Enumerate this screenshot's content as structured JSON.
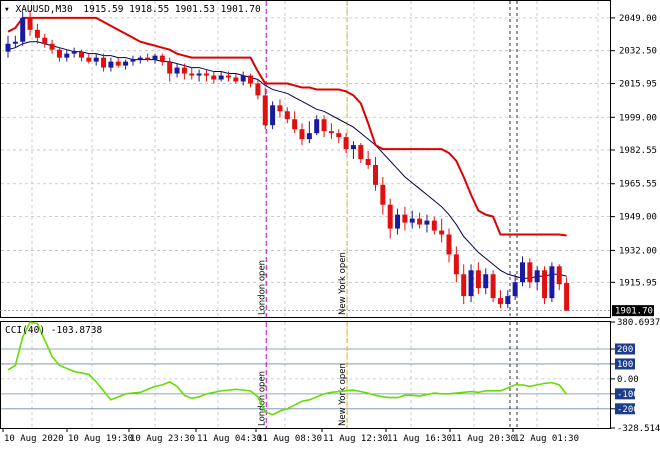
{
  "window": {
    "symbol_line": "XAUUSD,M30",
    "ohlc": "1915.59 1918.55 1901.53 1901.70",
    "cci_label": "CCI(40) -103.8738"
  },
  "price_axis": {
    "ticks": [
      "2049.00",
      "2032.50",
      "2015.95",
      "1999.00",
      "1982.55",
      "1965.55",
      "1949.00",
      "1932.00",
      "1915.95"
    ],
    "tick_values": [
      2049.0,
      2032.5,
      2015.95,
      1999.0,
      1982.55,
      1965.55,
      1949.0,
      1932.0,
      1915.95
    ],
    "current_price": "1901.70",
    "range": [
      1898.5,
      2057.5
    ]
  },
  "cci_axis": {
    "ticks": [
      "380.6937",
      "200",
      "100",
      "0.00",
      "-100",
      "-200",
      "-328.514"
    ],
    "tick_values": [
      380.69,
      200,
      100,
      0,
      -100,
      -200,
      -328.51
    ],
    "badge_ticks": [
      "200",
      "100",
      "-100",
      "-200"
    ],
    "range": [
      -328.514,
      380.6937
    ]
  },
  "time_axis": {
    "labels": [
      "10 Aug 2020",
      "10 Aug 19:30",
      "10 Aug 23:30",
      "11 Aug 04:30",
      "11 Aug 08:30",
      "11 Aug 12:30",
      "11 Aug 16:30",
      "11 Aug 20:30",
      "12 Aug 01:30"
    ]
  },
  "session_lines": [
    {
      "label": "London open",
      "color": "#c000c0",
      "bar": 35
    },
    {
      "label": "New York open",
      "color": "#e8b000",
      "bar": 46
    }
  ],
  "colors": {
    "bull": "#1a1aa0",
    "bear": "#e01010",
    "ma": "#000050",
    "stop_line": "#dd0000",
    "cci_line": "#66dd00",
    "grid": "#b8c0c8",
    "badge": "#1c3c8c",
    "price_badge": "#000000"
  },
  "chart_data": [
    {
      "type": "candlestick",
      "title": "XAUUSD,M30",
      "candles": [
        {
          "o": 2032,
          "h": 2040,
          "l": 2029,
          "c": 2036
        },
        {
          "o": 2036,
          "h": 2040,
          "l": 2034,
          "c": 2037
        },
        {
          "o": 2037,
          "h": 2052,
          "l": 2035,
          "c": 2049
        },
        {
          "o": 2049,
          "h": 2053,
          "l": 2040,
          "c": 2043
        },
        {
          "o": 2043,
          "h": 2046,
          "l": 2036,
          "c": 2039
        },
        {
          "o": 2039,
          "h": 2041,
          "l": 2034,
          "c": 2036
        },
        {
          "o": 2036,
          "h": 2038,
          "l": 2031,
          "c": 2033
        },
        {
          "o": 2033,
          "h": 2034,
          "l": 2027,
          "c": 2029
        },
        {
          "o": 2029,
          "h": 2033,
          "l": 2027,
          "c": 2031
        },
        {
          "o": 2031,
          "h": 2034,
          "l": 2029,
          "c": 2032
        },
        {
          "o": 2032,
          "h": 2033,
          "l": 2027,
          "c": 2029
        },
        {
          "o": 2029,
          "h": 2031,
          "l": 2026,
          "c": 2027
        },
        {
          "o": 2027,
          "h": 2031,
          "l": 2025,
          "c": 2029
        },
        {
          "o": 2029,
          "h": 2031,
          "l": 2022,
          "c": 2024
        },
        {
          "o": 2024,
          "h": 2029,
          "l": 2022,
          "c": 2027
        },
        {
          "o": 2027,
          "h": 2029,
          "l": 2024,
          "c": 2025
        },
        {
          "o": 2025,
          "h": 2028,
          "l": 2023,
          "c": 2027
        },
        {
          "o": 2027,
          "h": 2030,
          "l": 2025,
          "c": 2028
        },
        {
          "o": 2028,
          "h": 2030,
          "l": 2026,
          "c": 2029
        },
        {
          "o": 2029,
          "h": 2031,
          "l": 2027,
          "c": 2028
        },
        {
          "o": 2028,
          "h": 2031,
          "l": 2026,
          "c": 2030
        },
        {
          "o": 2030,
          "h": 2031,
          "l": 2025,
          "c": 2027
        },
        {
          "o": 2027,
          "h": 2029,
          "l": 2017,
          "c": 2021
        },
        {
          "o": 2021,
          "h": 2026,
          "l": 2019,
          "c": 2024
        },
        {
          "o": 2024,
          "h": 2026,
          "l": 2018,
          "c": 2021
        },
        {
          "o": 2021,
          "h": 2024,
          "l": 2018,
          "c": 2020
        },
        {
          "o": 2020,
          "h": 2023,
          "l": 2017,
          "c": 2021
        },
        {
          "o": 2021,
          "h": 2023,
          "l": 2017,
          "c": 2020
        },
        {
          "o": 2020,
          "h": 2022,
          "l": 2016,
          "c": 2018
        },
        {
          "o": 2018,
          "h": 2022,
          "l": 2017,
          "c": 2020
        },
        {
          "o": 2020,
          "h": 2022,
          "l": 2017,
          "c": 2019
        },
        {
          "o": 2019,
          "h": 2021,
          "l": 2016,
          "c": 2017
        },
        {
          "o": 2017,
          "h": 2022,
          "l": 2015,
          "c": 2020
        },
        {
          "o": 2020,
          "h": 2021,
          "l": 2014,
          "c": 2016
        },
        {
          "o": 2016,
          "h": 2018,
          "l": 2008,
          "c": 2010
        },
        {
          "o": 2010,
          "h": 2014,
          "l": 1993,
          "c": 1995
        },
        {
          "o": 1995,
          "h": 2007,
          "l": 1993,
          "c": 2005
        },
        {
          "o": 2005,
          "h": 2008,
          "l": 1999,
          "c": 2002
        },
        {
          "o": 2002,
          "h": 2004,
          "l": 1996,
          "c": 1998
        },
        {
          "o": 1998,
          "h": 2002,
          "l": 1991,
          "c": 1993
        },
        {
          "o": 1993,
          "h": 1996,
          "l": 1985,
          "c": 1988
        },
        {
          "o": 1988,
          "h": 1997,
          "l": 1986,
          "c": 1991
        },
        {
          "o": 1991,
          "h": 2000,
          "l": 1990,
          "c": 1998
        },
        {
          "o": 1998,
          "h": 2000,
          "l": 1989,
          "c": 1992
        },
        {
          "o": 1992,
          "h": 1996,
          "l": 1988,
          "c": 1991
        },
        {
          "o": 1991,
          "h": 1993,
          "l": 1986,
          "c": 1989
        },
        {
          "o": 1989,
          "h": 1991,
          "l": 1981,
          "c": 1983
        },
        {
          "o": 1983,
          "h": 1987,
          "l": 1978,
          "c": 1985
        },
        {
          "o": 1985,
          "h": 1986,
          "l": 1976,
          "c": 1978
        },
        {
          "o": 1978,
          "h": 1982,
          "l": 1973,
          "c": 1975
        },
        {
          "o": 1975,
          "h": 1979,
          "l": 1962,
          "c": 1965
        },
        {
          "o": 1965,
          "h": 1969,
          "l": 1950,
          "c": 1955
        },
        {
          "o": 1955,
          "h": 1958,
          "l": 1938,
          "c": 1943
        },
        {
          "o": 1943,
          "h": 1953,
          "l": 1940,
          "c": 1950
        },
        {
          "o": 1950,
          "h": 1954,
          "l": 1942,
          "c": 1946
        },
        {
          "o": 1946,
          "h": 1952,
          "l": 1943,
          "c": 1948
        },
        {
          "o": 1948,
          "h": 1951,
          "l": 1943,
          "c": 1945
        },
        {
          "o": 1945,
          "h": 1950,
          "l": 1941,
          "c": 1947
        },
        {
          "o": 1947,
          "h": 1949,
          "l": 1940,
          "c": 1942
        },
        {
          "o": 1942,
          "h": 1948,
          "l": 1936,
          "c": 1940
        },
        {
          "o": 1940,
          "h": 1943,
          "l": 1926,
          "c": 1930
        },
        {
          "o": 1930,
          "h": 1934,
          "l": 1916,
          "c": 1920
        },
        {
          "o": 1920,
          "h": 1925,
          "l": 1905,
          "c": 1909
        },
        {
          "o": 1909,
          "h": 1925,
          "l": 1906,
          "c": 1922
        },
        {
          "o": 1922,
          "h": 1926,
          "l": 1910,
          "c": 1913
        },
        {
          "o": 1913,
          "h": 1923,
          "l": 1910,
          "c": 1920
        },
        {
          "o": 1920,
          "h": 1922,
          "l": 1906,
          "c": 1908
        },
        {
          "o": 1908,
          "h": 1912,
          "l": 1903,
          "c": 1905
        },
        {
          "o": 1905,
          "h": 1912,
          "l": 1903,
          "c": 1909
        },
        {
          "o": 1909,
          "h": 1920,
          "l": 1907,
          "c": 1916
        },
        {
          "o": 1916,
          "h": 1929,
          "l": 1914,
          "c": 1926
        },
        {
          "o": 1926,
          "h": 1928,
          "l": 1913,
          "c": 1916
        },
        {
          "o": 1916,
          "h": 1924,
          "l": 1912,
          "c": 1922
        },
        {
          "o": 1922,
          "h": 1924,
          "l": 1905,
          "c": 1908
        },
        {
          "o": 1908,
          "h": 1926,
          "l": 1906,
          "c": 1924
        },
        {
          "o": 1924,
          "h": 1925,
          "l": 1912,
          "c": 1915
        },
        {
          "o": 1915.59,
          "h": 1918.55,
          "l": 1901.53,
          "c": 1901.7
        }
      ],
      "moving_average": [
        2033,
        2034,
        2036,
        2037,
        2037,
        2036,
        2035,
        2034,
        2033,
        2032,
        2032,
        2031,
        2031,
        2030,
        2030,
        2029,
        2029,
        2028,
        2028,
        2028,
        2028,
        2027,
        2027,
        2026,
        2025,
        2024,
        2024,
        2023,
        2022,
        2022,
        2021,
        2021,
        2020,
        2019,
        2018,
        2015,
        2013,
        2012,
        2011,
        2009,
        2007,
        2005,
        2003,
        2002,
        2000,
        1998,
        1996,
        1994,
        1991,
        1988,
        1985,
        1981,
        1977,
        1973,
        1969,
        1966,
        1963,
        1960,
        1957,
        1954,
        1950,
        1945,
        1939,
        1935,
        1931,
        1928,
        1925,
        1922,
        1920,
        1919,
        1918,
        1918,
        1919,
        1919,
        1920,
        1920,
        1919
      ],
      "stop_line": [
        2042,
        2044,
        2049,
        2049,
        2049,
        2049,
        2049,
        2049,
        2049,
        2049,
        2049,
        2049,
        2049,
        2047,
        2045,
        2043,
        2041,
        2039,
        2037,
        2036,
        2035,
        2034,
        2033,
        2031,
        2030,
        2029,
        2029,
        2029,
        2029,
        2029,
        2029,
        2029,
        2029,
        2029,
        2022,
        2016,
        2016,
        2016,
        2016,
        2015,
        2014,
        2014,
        2013,
        2013,
        2013,
        2013,
        2012,
        2010,
        2006,
        1996,
        1985,
        1983,
        1983,
        1983,
        1983,
        1983,
        1983,
        1983,
        1983,
        1983,
        1981,
        1977,
        1969,
        1960,
        1952,
        1950,
        1949,
        1940,
        1940,
        1940,
        1940,
        1940,
        1940,
        1940,
        1940,
        1940,
        1939.5
      ],
      "moving_average_color": "#000050",
      "stop_line_color": "#dd0000"
    },
    {
      "type": "line",
      "title": "CCI(40) -103.8738",
      "series": [
        {
          "name": "CCI(40)",
          "values": [
            60,
            90,
            280,
            380,
            370,
            260,
            150,
            90,
            70,
            50,
            40,
            30,
            -20,
            -80,
            -140,
            -120,
            -100,
            -95,
            -90,
            -70,
            -50,
            -40,
            -20,
            -50,
            -110,
            -130,
            -120,
            -100,
            -90,
            -80,
            -75,
            -70,
            -75,
            -80,
            -120,
            -220,
            -240,
            -215,
            -200,
            -175,
            -150,
            -140,
            -120,
            -100,
            -90,
            -85,
            -80,
            -75,
            -85,
            -95,
            -110,
            -120,
            -125,
            -125,
            -110,
            -110,
            -115,
            -105,
            -95,
            -100,
            -100,
            -95,
            -90,
            -85,
            -90,
            -80,
            -80,
            -80,
            -60,
            -40,
            -40,
            -50,
            -40,
            -30,
            -25,
            -40,
            -103.8738
          ]
        }
      ],
      "ylim": [
        -328.514,
        380.6937
      ],
      "levels": [
        200,
        100,
        -100,
        -200
      ]
    }
  ]
}
